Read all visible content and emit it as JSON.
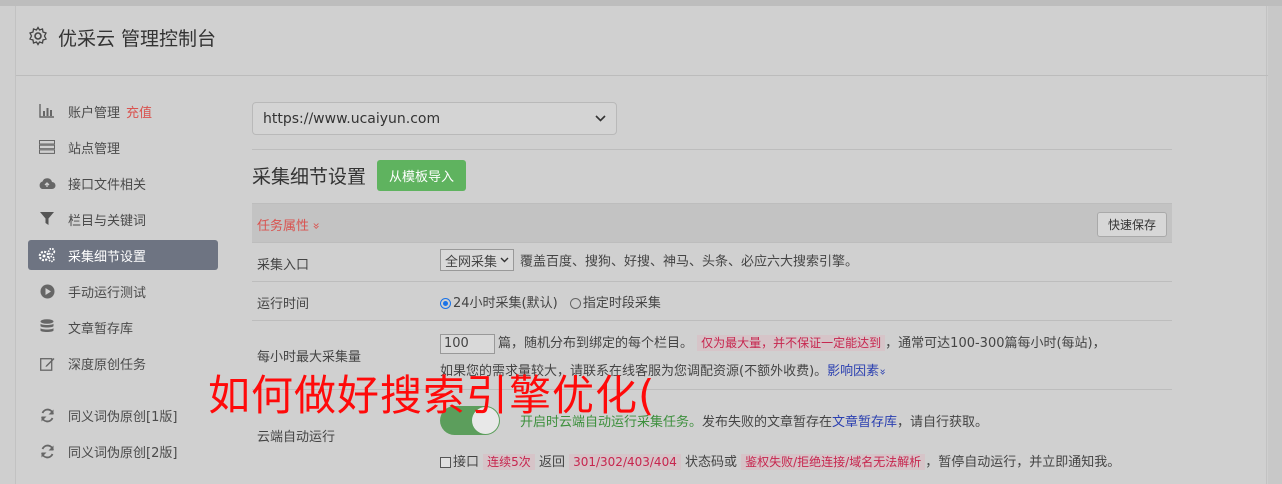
{
  "header": {
    "title": "优采云 管理控制台",
    "icon": "gear-icon"
  },
  "sidebar": {
    "items": [
      {
        "label": "账户管理",
        "extra": "充值",
        "icon": "bar-chart-icon"
      },
      {
        "label": "站点管理",
        "icon": "server-icon"
      },
      {
        "label": "接口文件相关",
        "icon": "cloud-upload-icon"
      },
      {
        "label": "栏目与关键词",
        "icon": "filter-icon"
      },
      {
        "label": "采集细节设置",
        "icon": "cogs-icon",
        "active": true
      },
      {
        "label": "手动运行测试",
        "icon": "play-circle-icon"
      },
      {
        "label": "文章暂存库",
        "icon": "database-icon"
      },
      {
        "label": "深度原创任务",
        "icon": "edit-icon"
      },
      {
        "label": "同义词伪原创[1版]",
        "icon": "refresh-icon"
      },
      {
        "label": "同义词伪原创[2版]",
        "icon": "refresh-icon"
      }
    ]
  },
  "main": {
    "site_select": "https://www.ucaiyun.com",
    "section_title": "采集细节设置",
    "import_button": "从模板导入",
    "task_header": "任务属性",
    "task_header_arrow": "»",
    "save_button": "快速保存",
    "rows": {
      "entry": {
        "label": "采集入口",
        "select": "全网采集",
        "desc": "覆盖百度、搜狗、好搜、神马、头条、必应六大搜索引擎。"
      },
      "runtime": {
        "label": "运行时间",
        "opt1": "24小时采集(默认)",
        "opt2": "指定时段采集"
      },
      "max": {
        "label": "每小时最大采集量",
        "value": "100",
        "text1": "篇，随机分布到绑定的每个栏目。",
        "warn": "仅为最大量，并不保证一定能达到",
        "text2": "，通常可达100-300篇每小时(每站)，",
        "line2_prefix": "如果您的需求量较大，请联系在线客服为您调配资源(不额外收费)。",
        "link": "影响因素",
        "link_arrow": "»"
      },
      "cloud": {
        "label": "云端自动运行",
        "green": "开启时云端自动运行采集任务。",
        "text1": "发布失败的文章暂存在",
        "link": "文章暂存库",
        "text2": "，请自行获取。",
        "chk_label": "接口",
        "warn1": "连续5次",
        "mid1": "返回",
        "warn2": "301/302/403/404",
        "mid2": "状态码或",
        "warn3": "鉴权失败/拒绝连接/域名无法解析",
        "tail": "，暂停自动运行，并立即通知我。"
      }
    }
  },
  "overlay_text": "如何做好搜索引擎优化("
}
